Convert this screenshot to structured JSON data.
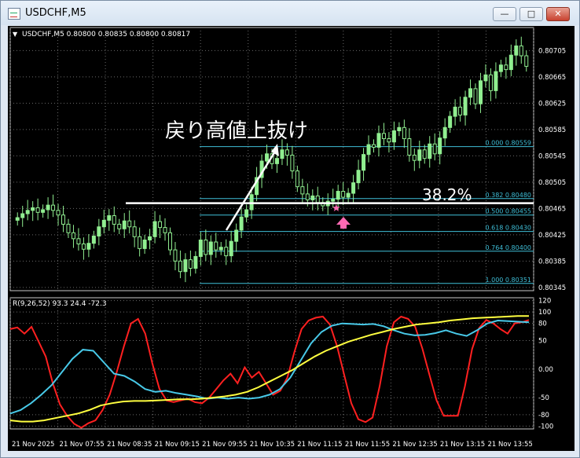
{
  "window": {
    "title": "USDCHF,M5",
    "buttons": {
      "minimize": "—",
      "maximize": "□",
      "close": "✕"
    }
  },
  "chart_header": {
    "arrow": "▼",
    "text": "USDCHF,M5  0.80800 0.80835 0.80800 0.80817"
  },
  "annotations": {
    "breakout_label": "戻り高値上抜け",
    "fib_pct_label": "38.2%"
  },
  "colors": {
    "background": "#000000",
    "bull_candle": "#90ee90",
    "bear_candle": "#000000",
    "fib_line": "#3fbfd8",
    "rci_short": "#ff2020",
    "rci_mid": "#48c9e8",
    "rci_long": "#ffff40",
    "hline": "#ffffff",
    "marker": "#ff69b4"
  },
  "chart_data": [
    {
      "type": "candlestick",
      "symbol": "USDCHF",
      "timeframe": "M5",
      "ylim": [
        0.8034,
        0.8074
      ],
      "y_ticks": [
        "0.80705",
        "0.80665",
        "0.80625",
        "0.80585",
        "0.80545",
        "0.80505",
        "0.80465",
        "0.80425",
        "0.80385",
        "0.80345"
      ],
      "x_ticks": [
        "21 Nov 2025",
        "21 Nov 07:55",
        "21 Nov 08:35",
        "21 Nov 09:15",
        "21 Nov 09:55",
        "21 Nov 10:35",
        "21 Nov 11:15",
        "21 Nov 11:55",
        "21 Nov 12:35",
        "21 Nov 13:15",
        "21 Nov 13:55"
      ],
      "fibonacci": [
        {
          "label": "0.000  0.80559",
          "value": 0.80559
        },
        {
          "label": "0.382  0.80480",
          "value": 0.8048
        },
        {
          "label": "0.500  0.80455",
          "value": 0.80455
        },
        {
          "label": "0.618  0.80430",
          "value": 0.8043
        },
        {
          "label": "0.764  0.80400",
          "value": 0.804
        },
        {
          "label": "1.000  0.80351",
          "value": 0.80351
        }
      ],
      "horizontal_line": 0.80473,
      "close_series": [
        0.80451,
        0.80457,
        0.80462,
        0.80466,
        0.80459,
        0.80463,
        0.8047,
        0.80462,
        0.80455,
        0.80441,
        0.80428,
        0.80419,
        0.80411,
        0.80403,
        0.80412,
        0.80423,
        0.80437,
        0.80447,
        0.80454,
        0.80441,
        0.80434,
        0.80446,
        0.80437,
        0.80422,
        0.80404,
        0.80417,
        0.80422,
        0.80445,
        0.80436,
        0.80428,
        0.80402,
        0.80385,
        0.80369,
        0.80387,
        0.80374,
        0.80392,
        0.80417,
        0.80395,
        0.80414,
        0.80402,
        0.80406,
        0.80393,
        0.80415,
        0.80432,
        0.80452,
        0.80463,
        0.80486,
        0.80512,
        0.80537,
        0.80548,
        0.80533,
        0.80541,
        0.80554,
        0.80546,
        0.80522,
        0.80498,
        0.80487,
        0.80478,
        0.80484,
        0.80474,
        0.80469,
        0.80476,
        0.80479,
        0.80491,
        0.80482,
        0.80488,
        0.80504,
        0.80523,
        0.80547,
        0.80562,
        0.80558,
        0.80579,
        0.80571,
        0.80566,
        0.80583,
        0.80588,
        0.80571,
        0.80546,
        0.80538,
        0.80554,
        0.80541,
        0.80563,
        0.80548,
        0.80572,
        0.80588,
        0.80605,
        0.80619,
        0.80607,
        0.80634,
        0.80647,
        0.80624,
        0.80659,
        0.80668,
        0.80644,
        0.80673,
        0.80683,
        0.80676,
        0.80698,
        0.80712,
        0.80697,
        0.80681
      ]
    },
    {
      "type": "line",
      "title": "R(9,26,52) 93.3 24.4 -72.3",
      "ylim": [
        -105,
        125
      ],
      "y_ticks": [
        "120",
        "100",
        "80",
        "50",
        "0.00",
        "-50",
        "-80",
        "-100"
      ],
      "series": [
        {
          "values": [
            70,
            73,
            62,
            74,
            48,
            22,
            -25,
            -62,
            -82,
            -96,
            -103,
            -95,
            -90,
            -72,
            -45,
            -5,
            40,
            80,
            88,
            62,
            10,
            -35,
            -55,
            -58,
            -55,
            -52,
            -58,
            -60,
            -50,
            -35,
            -20,
            -8,
            -25,
            3,
            -15,
            -5,
            -25,
            -45,
            -38,
            -15,
            30,
            70,
            85,
            90,
            92,
            78,
            40,
            -10,
            -60,
            -88,
            -93,
            -85,
            -30,
            40,
            82,
            92,
            88,
            74,
            36,
            -10,
            -55,
            -82,
            -82,
            -82,
            -30,
            35,
            72,
            86,
            80,
            70,
            62,
            80,
            82,
            86
          ]
        },
        {
          "values": [
            -78,
            -72,
            -60,
            -45,
            -28,
            -5,
            18,
            34,
            32,
            12,
            -8,
            -12,
            -22,
            -35,
            -40,
            -38,
            -42,
            -45,
            -48,
            -52,
            -50,
            -52,
            -50,
            -52,
            -50,
            -45,
            -35,
            -15,
            15,
            45,
            65,
            76,
            80,
            79,
            78,
            79,
            75,
            68,
            62,
            59,
            60,
            63,
            68,
            62,
            58,
            68,
            80,
            85,
            84,
            83,
            82
          ]
        },
        {
          "values": [
            -90,
            -92,
            -92,
            -90,
            -86,
            -82,
            -78,
            -72,
            -64,
            -60,
            -57,
            -56,
            -56,
            -55,
            -54,
            -53,
            -53,
            -52,
            -50,
            -48,
            -45,
            -40,
            -32,
            -22,
            -12,
            -2,
            10,
            22,
            32,
            40,
            48,
            54,
            60,
            65,
            70,
            74,
            78,
            80,
            82,
            85,
            87,
            89,
            90,
            91,
            92,
            93,
            93
          ]
        }
      ]
    }
  ]
}
